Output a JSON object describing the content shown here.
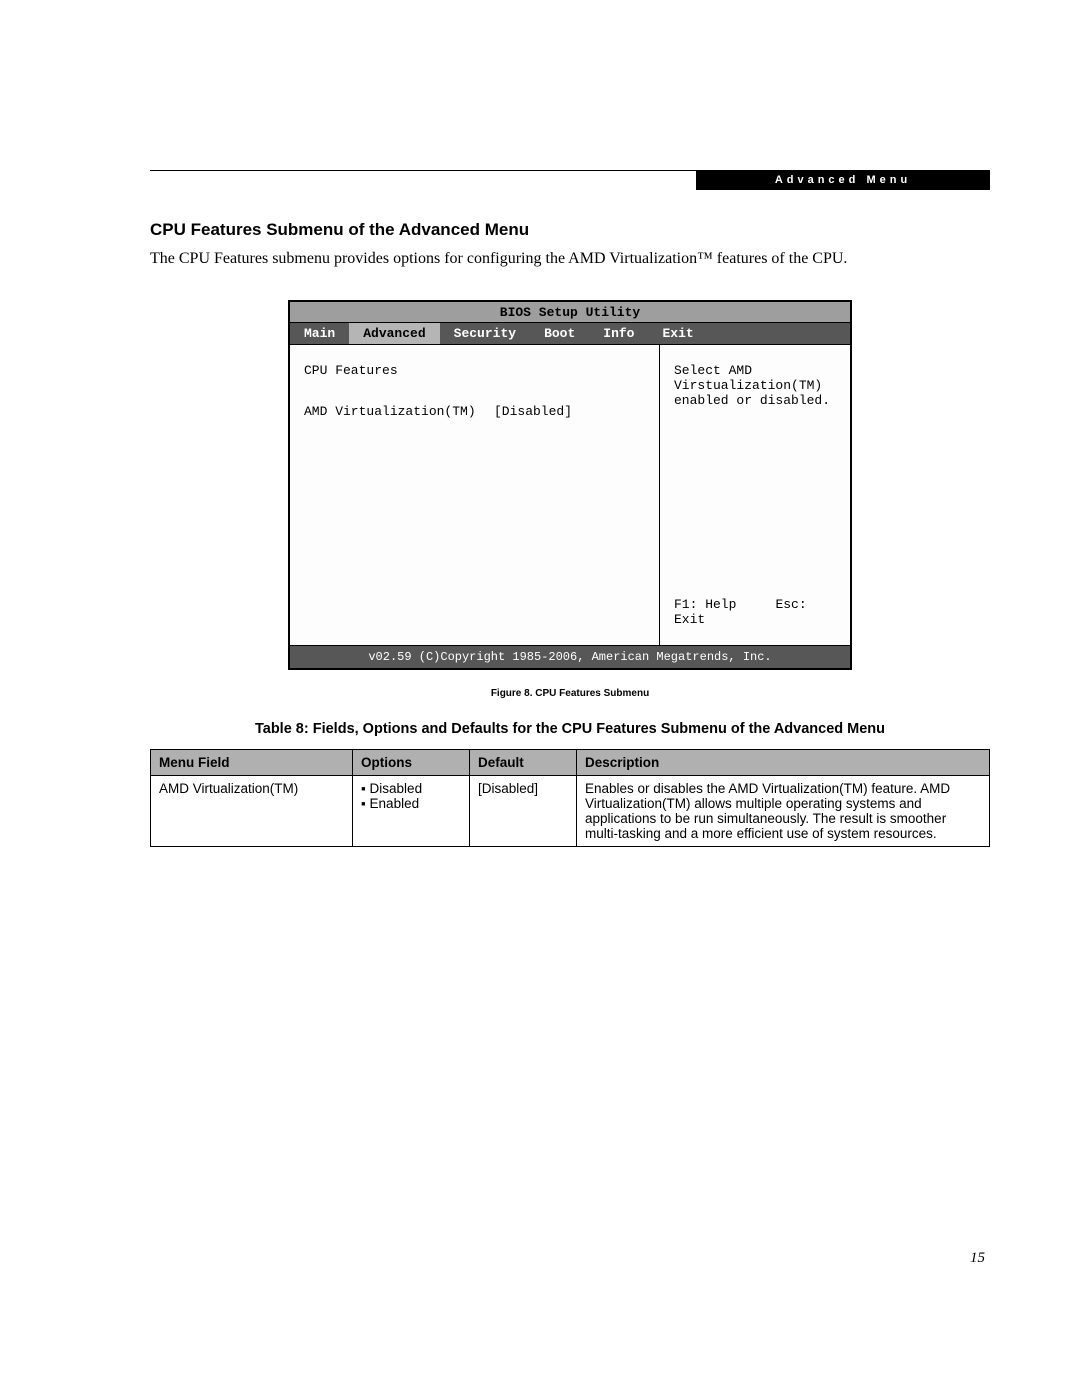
{
  "header": {
    "label": "Advanced Menu"
  },
  "section": {
    "title": "CPU Features Submenu of the Advanced Menu",
    "intro": "The CPU Features submenu provides options for configuring the AMD Virtualization™ features of the CPU."
  },
  "bios": {
    "title": "BIOS Setup Utility",
    "tabs": [
      "Main",
      "Advanced",
      "Security",
      "Boot",
      "Info",
      "Exit"
    ],
    "active_tab": "Advanced",
    "left_heading": "CPU Features",
    "row": {
      "label": "AMD Virtualization(TM)",
      "value": "[Disabled]"
    },
    "help_text": "Select AMD Virstualization(TM) enabled or disabled.",
    "footer_keys": {
      "f1": "F1: Help",
      "esc": "Esc: Exit"
    },
    "copyright": "v02.59 (C)Copyright 1985-2006, American Megatrends, Inc."
  },
  "figure_caption": "Figure 8.  CPU Features Submenu",
  "table": {
    "title": "Table 8: Fields, Options and Defaults for the CPU Features Submenu of the Advanced Menu",
    "headers": [
      "Menu Field",
      "Options",
      "Default",
      "Description"
    ],
    "row": {
      "menu_field": "AMD Virtualization(TM)",
      "options": [
        "Disabled",
        "Enabled"
      ],
      "default": "[Disabled]",
      "description": "Enables or disables the AMD Virtualization(TM) feature. AMD Virtualization(TM) allows multiple operating systems and applications to be run simultaneously. The result is smoother multi-tasking and a more efficient use of system resources."
    }
  },
  "page_number": "15"
}
